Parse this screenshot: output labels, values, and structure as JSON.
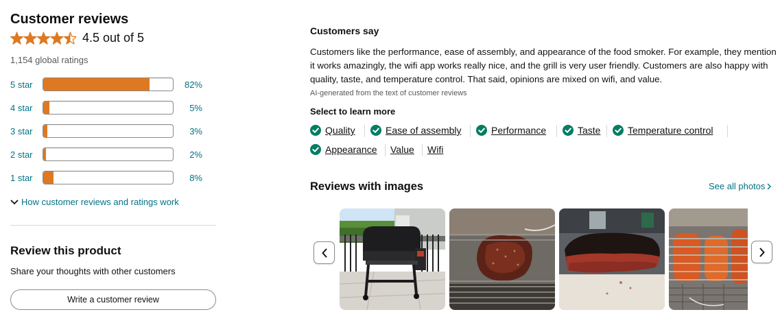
{
  "customer_reviews": {
    "title": "Customer reviews",
    "average_rating": 4.5,
    "average_text": "4.5 out of 5",
    "global_ratings": "1,154 global ratings",
    "star_color": "#de7921",
    "histogram": [
      {
        "label": "5 star",
        "percent_text": "82%",
        "fraction": 0.82
      },
      {
        "label": "4 star",
        "percent_text": "5%",
        "fraction": 0.05
      },
      {
        "label": "3 star",
        "percent_text": "3%",
        "fraction": 0.03
      },
      {
        "label": "2 star",
        "percent_text": "2%",
        "fraction": 0.02
      },
      {
        "label": "1 star",
        "percent_text": "8%",
        "fraction": 0.08
      }
    ],
    "how_it_works": "How customer reviews and ratings work"
  },
  "review_product": {
    "title": "Review this product",
    "subtitle": "Share your thoughts with other customers",
    "button_label": "Write a customer review"
  },
  "customers_say": {
    "title": "Customers say",
    "summary": "Customers like the performance, ease of assembly, and appearance of the food smoker. For example, they mention it works amazingly, the wifi app works really nice, and the grill is very user friendly. Customers are also happy with quality, taste, and temperature control. That said, opinions are mixed on wifi, and value.",
    "ai_note": "AI-generated from the text of customer reviews",
    "learn_more": "Select to learn more",
    "check_color": "#067d62",
    "aspects": [
      {
        "label": "Quality",
        "positive": true
      },
      {
        "label": "Ease of assembly",
        "positive": true
      },
      {
        "label": "Performance",
        "positive": true
      },
      {
        "label": "Taste",
        "positive": true
      },
      {
        "label": "Temperature control",
        "positive": true
      },
      {
        "label": "Appearance",
        "positive": true
      },
      {
        "label": "Value",
        "positive": false
      },
      {
        "label": "Wifi",
        "positive": false
      }
    ]
  },
  "reviews_with_images": {
    "title": "Reviews with images",
    "see_all": "See all photos"
  }
}
